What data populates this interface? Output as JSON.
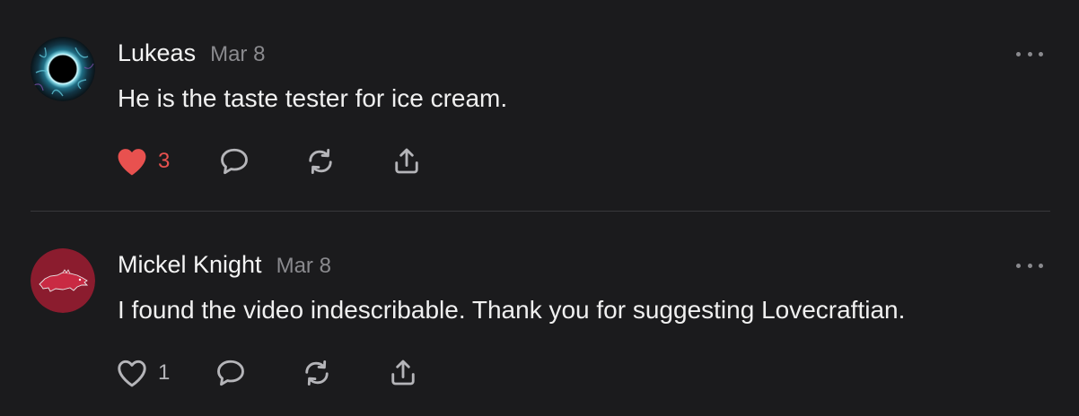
{
  "colors": {
    "background": "#1b1b1d",
    "text": "#f2f2f2",
    "muted": "#8a8a8e",
    "like_active": "#e8514f",
    "divider": "#38383b"
  },
  "comments": [
    {
      "author": "Lukeas",
      "date": "Mar 8",
      "text": "He is the taste tester for ice cream.",
      "likes": "3",
      "liked": true,
      "avatar": "eclipse-avatar",
      "icons": [
        "heart-filled-icon",
        "comment-icon",
        "repost-icon",
        "share-icon",
        "more-icon"
      ]
    },
    {
      "author": "Mickel Knight",
      "date": "Mar 8",
      "text": "I found the video indescribable. Thank you for suggesting Lovecraftian.",
      "likes": "1",
      "liked": false,
      "avatar": "razorback-avatar",
      "icons": [
        "heart-outline-icon",
        "comment-icon",
        "repost-icon",
        "share-icon",
        "more-icon"
      ]
    }
  ]
}
